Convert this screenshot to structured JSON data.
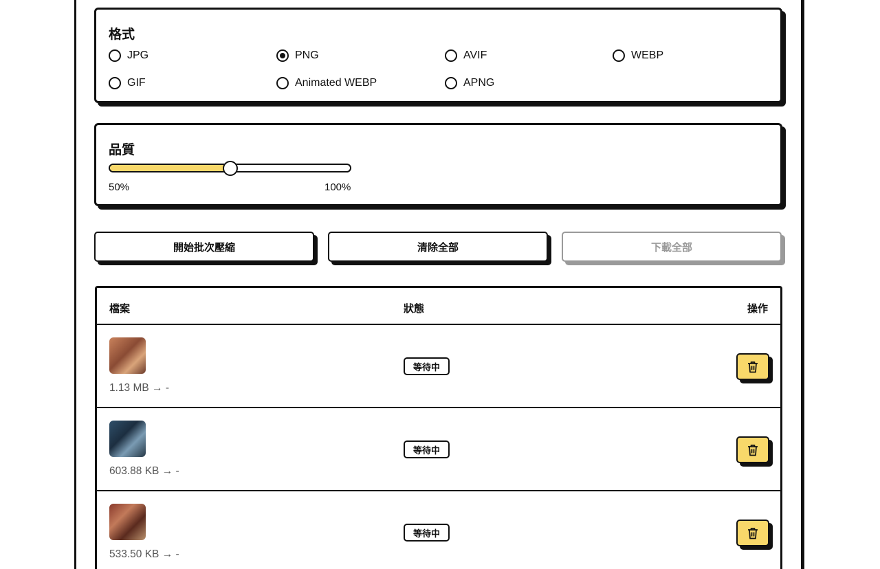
{
  "format": {
    "title": "格式",
    "options": [
      "JPG",
      "PNG",
      "AVIF",
      "WEBP",
      "GIF",
      "Animated WEBP",
      "APNG"
    ],
    "selected": "PNG"
  },
  "quality": {
    "title": "品質",
    "value_percent": 50,
    "min_label": "50%",
    "max_label": "100%"
  },
  "actions": {
    "start_label": "開始批次壓縮",
    "clear_label": "清除全部",
    "download_label": "下載全部"
  },
  "table": {
    "headers": {
      "file": "檔案",
      "status": "狀態",
      "ops": "操作"
    },
    "rows": [
      {
        "size": "1.13 MB → -",
        "status": "等待中"
      },
      {
        "size": "603.88 KB → -",
        "status": "等待中"
      },
      {
        "size": "533.50 KB → -",
        "status": "等待中"
      }
    ]
  },
  "colors": {
    "accent": "#f8d86a",
    "ink": "#111111",
    "disabled": "#9a9a9a"
  },
  "icons": {
    "delete": "trash-icon"
  }
}
